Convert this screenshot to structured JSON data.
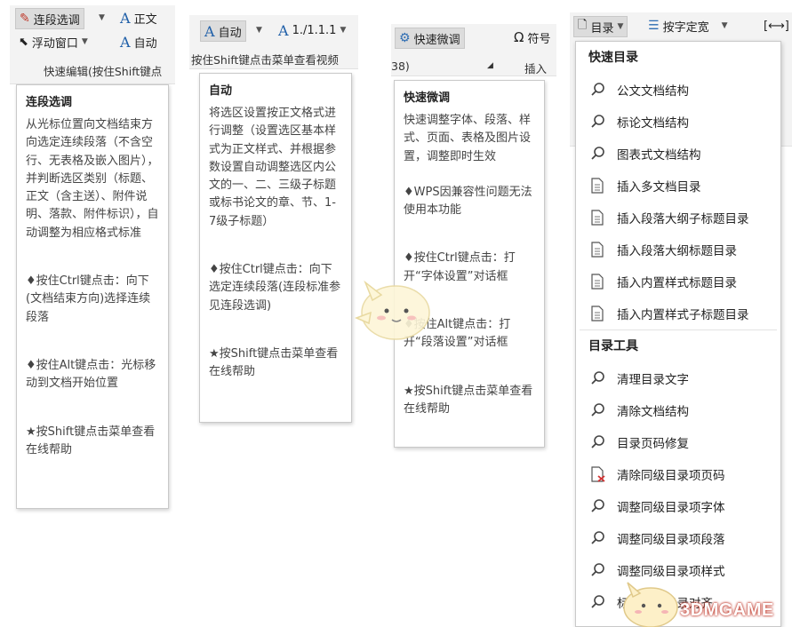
{
  "panel1": {
    "ribbon": {
      "btn1": "连段选调",
      "btn2": "正文",
      "btn3": "浮动窗口",
      "btn4": "自动",
      "group_label": "快速编辑(按住Shift键点"
    },
    "tooltip": {
      "title": "连段选调",
      "desc": "从光标位置向文档结束方向选定连续段落（不含空行、无表格及嵌入图片），并判断选区类别（标题、正文（含主送）、附件说明、落款、附件标识），自动调整为相应格式标准",
      "ctrl": "♦按住Ctrl键点击：向下(文档结束方向)选择连续段落",
      "alt": "♦按住Alt键点击：光标移动到文档开始位置",
      "shift": "★按Shift键点击菜单查看在线帮助"
    }
  },
  "panel2": {
    "ribbon": {
      "btn1": "自动",
      "btn2": "1./1.1.1",
      "group_label": "按住Shift键点击菜单查看视频"
    },
    "tooltip": {
      "title": "自动",
      "desc": "将选区设置按正文格式进行调整（设置选区基本样式为正文样式、并根据参数设置自动调整选区内公文的一、二、三级子标题或标书论文的章、节、1-7级子标题）",
      "ctrl": "♦按住Ctrl键点击：向下选定连续段落(连段标准参见连段选调)",
      "shift": "★按Shift键点击菜单查看在线帮助"
    }
  },
  "panel3": {
    "ribbon": {
      "btn1": "快速微调",
      "btn2": "符号",
      "left_label": "38)",
      "group_label": "插入"
    },
    "tooltip": {
      "title": "快速微调",
      "desc": "快速调整字体、段落、样式、页面、表格及图片设置，调整即时生效",
      "note": "♦WPS因兼容性问题无法使用本功能",
      "ctrl": "♦按住Ctrl键点击：打开“字体设置”对话框",
      "alt": "♦按住Alt键点击：打开“段落设置”对话框",
      "shift": "★按Shift键点击菜单查看在线帮助"
    }
  },
  "panel4": {
    "ribbon": {
      "btn1": "目录",
      "btn2": "按字定宽"
    },
    "menu": {
      "section1": "快速目录",
      "items1": [
        {
          "label": "公文文档结构",
          "icon": "search-icon"
        },
        {
          "label": "标论文档结构",
          "icon": "search-icon"
        },
        {
          "label": "图表式文档结构",
          "icon": "search-icon"
        },
        {
          "label": "插入多文档目录",
          "icon": "document-icon"
        },
        {
          "label": "插入段落大纲子标题目录",
          "icon": "document-icon"
        },
        {
          "label": "插入段落大纲标题目录",
          "icon": "document-icon"
        },
        {
          "label": "插入内置样式标题目录",
          "icon": "document-icon"
        },
        {
          "label": "插入内置样式子标题目录",
          "icon": "document-icon"
        }
      ],
      "section2": "目录工具",
      "items2": [
        {
          "label": "清理目录文字",
          "icon": "search-icon"
        },
        {
          "label": "清除文档结构",
          "icon": "search-icon"
        },
        {
          "label": "目录页码修复",
          "icon": "search-icon"
        },
        {
          "label": "清除同级目录项页码",
          "icon": "document-delete-icon"
        },
        {
          "label": "调整同级目录项字体",
          "icon": "search-icon"
        },
        {
          "label": "调整同级目录项段落",
          "icon": "search-icon"
        },
        {
          "label": "调整同级目录项样式",
          "icon": "search-icon"
        },
        {
          "label": "标题级别目录对齐",
          "icon": "search-icon"
        }
      ]
    }
  },
  "watermark": "3DMGAME"
}
